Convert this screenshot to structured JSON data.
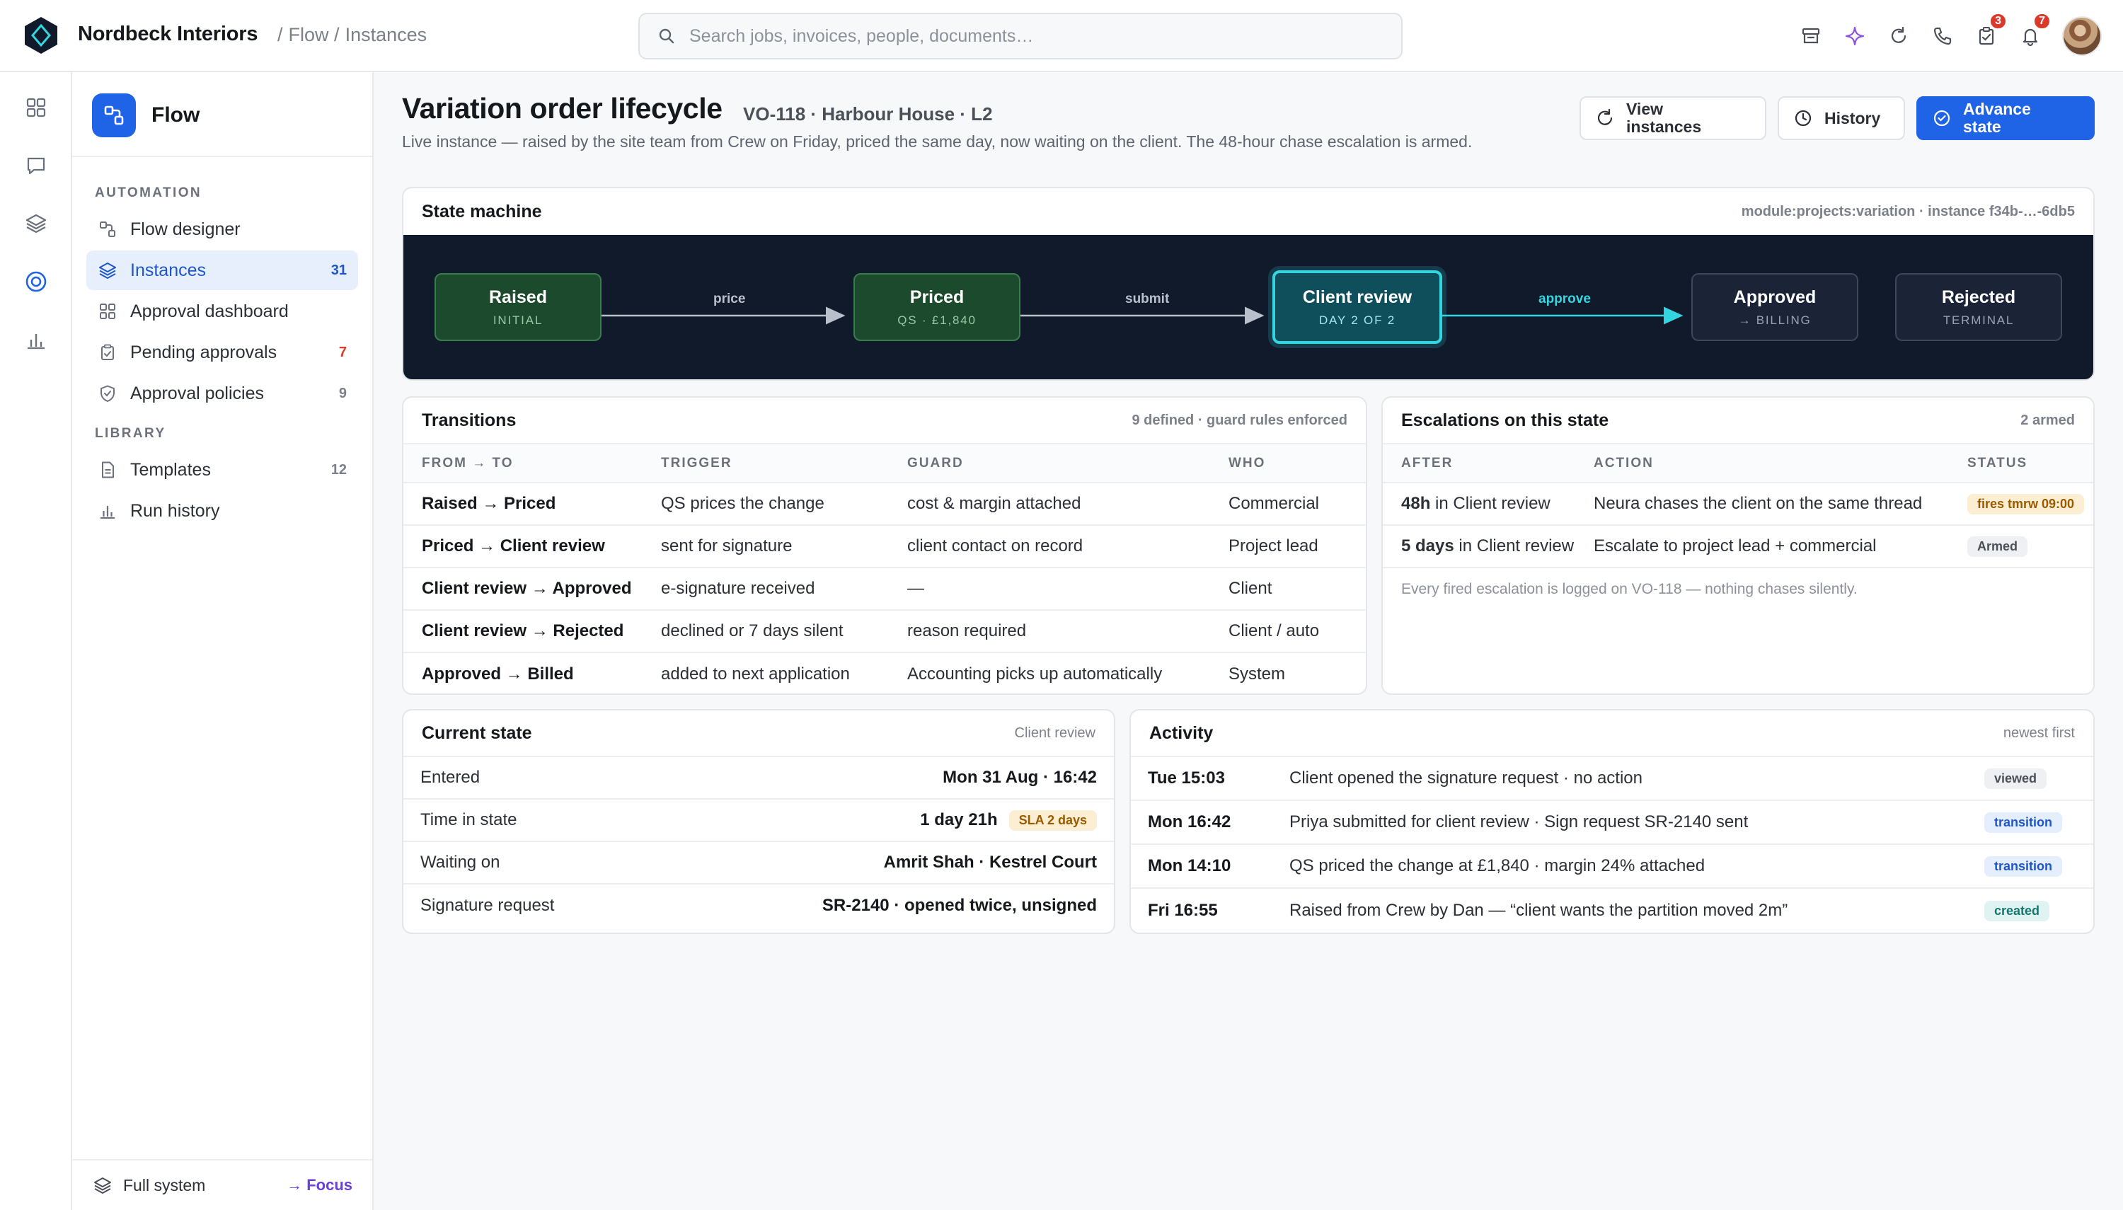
{
  "app": {
    "brand": "Nordbeck Interiors",
    "breadcrumb": [
      "Flow",
      "Instances"
    ]
  },
  "search": {
    "placeholder": "Search jobs, invoices, people, documents…"
  },
  "topbar": {
    "tasks_badge": "3",
    "notifications_badge": "7"
  },
  "sidebar": {
    "title": "Flow",
    "section_automation": "AUTOMATION",
    "section_library": "LIBRARY",
    "items": [
      {
        "label": "Flow designer",
        "count": ""
      },
      {
        "label": "Instances",
        "count": "31"
      },
      {
        "label": "Approval dashboard",
        "count": ""
      },
      {
        "label": "Pending approvals",
        "count": "7"
      },
      {
        "label": "Approval policies",
        "count": "9"
      },
      {
        "label": "Templates",
        "count": "12"
      },
      {
        "label": "Run history",
        "count": ""
      }
    ],
    "footer_label": "Full system",
    "footer_action": "→ Focus"
  },
  "page": {
    "title": "Variation order lifecycle",
    "subtitle": "VO-118 · Harbour House · L2",
    "description": "Live instance — raised by the site team from Crew on Friday, priced the same day, now waiting on the client. The 48-hour chase escalation is armed.",
    "buttons": {
      "view_instances": "View instances",
      "history": "History",
      "advance": "Advance state"
    }
  },
  "state_machine": {
    "title": "State machine",
    "meta": "module:projects:variation · instance f34b-…-6db5",
    "states": [
      {
        "name": "Raised",
        "sub": "INITIAL",
        "status": "done"
      },
      {
        "name": "Priced",
        "sub": "QS · £1,840",
        "status": "done"
      },
      {
        "name": "Client review",
        "sub": "DAY 2 OF 2",
        "status": "current"
      },
      {
        "name": "Approved",
        "sub": "→ BILLING",
        "status": "pending"
      },
      {
        "name": "Rejected",
        "sub": "TERMINAL",
        "status": "pending"
      }
    ],
    "edges": [
      "price",
      "submit",
      "approve"
    ]
  },
  "transitions": {
    "title": "Transitions",
    "meta": "9 defined · guard rules enforced",
    "columns": [
      "FROM → TO",
      "TRIGGER",
      "GUARD",
      "WHO"
    ],
    "rows": [
      [
        "Raised → Priced",
        "QS prices the change",
        "cost & margin attached",
        "Commercial"
      ],
      [
        "Priced → Client review",
        "sent for signature",
        "client contact on record",
        "Project lead"
      ],
      [
        "Client review → Approved",
        "e-signature received",
        "—",
        "Client"
      ],
      [
        "Client review → Rejected",
        "declined or 7 days silent",
        "reason required",
        "Client / auto"
      ],
      [
        "Approved → Billed",
        "added to next application",
        "Accounting picks up automatically",
        "System"
      ]
    ]
  },
  "escalations": {
    "title": "Escalations on this state",
    "meta": "2 armed",
    "columns": [
      "AFTER",
      "ACTION",
      "STATUS"
    ],
    "rows": [
      {
        "after_bold": "48h",
        "after_rest": " in Client review",
        "action": "Neura chases the client on the same thread",
        "status": "fires tmrw 09:00",
        "tone": "amber"
      },
      {
        "after_bold": "5 days",
        "after_rest": " in Client review",
        "action": "Escalate to project lead + commercial",
        "status": "Armed",
        "tone": "gray"
      }
    ],
    "note": "Every fired escalation is logged on VO-118 — nothing chases silently."
  },
  "current_state": {
    "title": "Current state",
    "meta": "Client review",
    "rows": [
      {
        "key": "Entered",
        "value": "Mon 31 Aug · 16:42",
        "pill": ""
      },
      {
        "key": "Time in state",
        "value": "1 day 21h",
        "pill": "SLA 2 days"
      },
      {
        "key": "Waiting on",
        "value": "Amrit Shah · Kestrel Court",
        "pill": ""
      },
      {
        "key": "Signature request",
        "value": "SR-2140 · opened twice, unsigned",
        "pill": ""
      }
    ]
  },
  "activity": {
    "title": "Activity",
    "meta": "newest first",
    "rows": [
      {
        "time": "Tue 15:03",
        "text": "Client opened the signature request · no action",
        "tag": "viewed",
        "tone": "gray"
      },
      {
        "time": "Mon 16:42",
        "text": "Priya submitted for client review · Sign request SR-2140 sent",
        "tag": "transition",
        "tone": "blue"
      },
      {
        "time": "Mon 14:10",
        "text": "QS priced the change at £1,840 · margin 24% attached",
        "tag": "transition",
        "tone": "blue"
      },
      {
        "time": "Fri 16:55",
        "text": "Raised from Crew by Dan — “client wants the partition moved 2m”",
        "tag": "created",
        "tone": "teal"
      }
    ]
  },
  "colors": {
    "accent": "#1f63e6",
    "current_state": "#33d6e0",
    "canvas": "#101a2b"
  }
}
